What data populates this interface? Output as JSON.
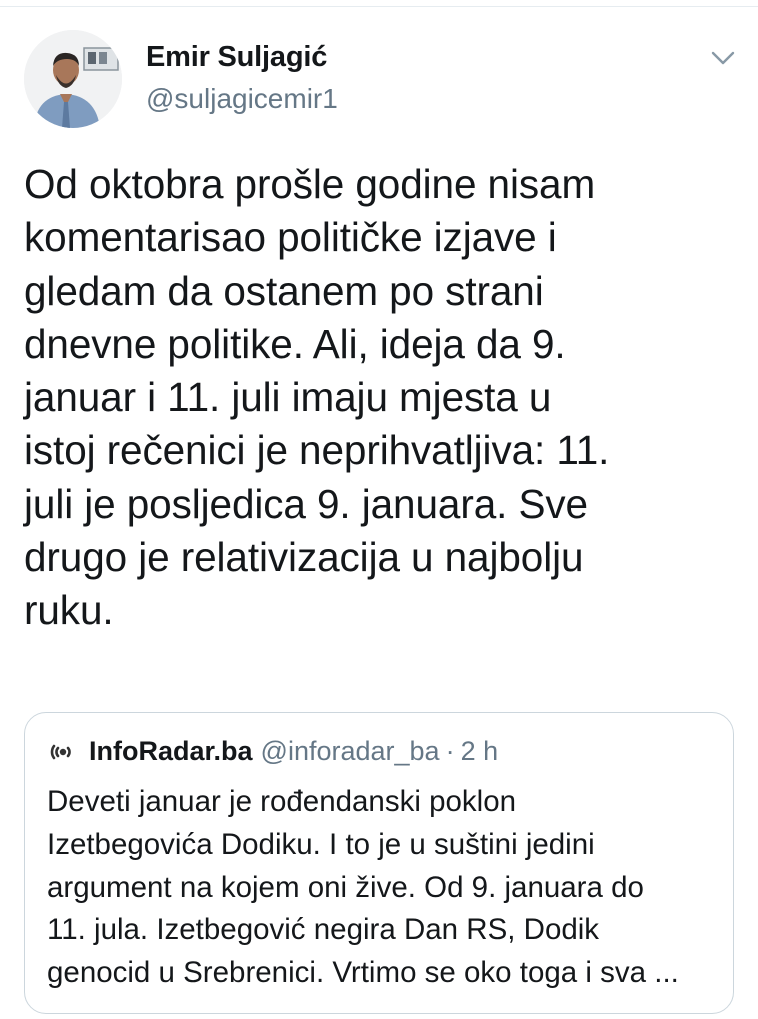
{
  "tweet": {
    "author": {
      "display_name": "Emir Suljagić",
      "handle": "@suljagicemir1",
      "avatar_icon": "user-photo-avatar"
    },
    "menu_icon": "chevron-down-icon",
    "text": "Od oktobra prošle godine nisam\nkomentarisao političke izjave i\ngledam da ostanem po strani\ndnevne politike. Ali, ideja da 9.\njanuar i 11. juli imaju mjesta u\nistoj rečenici je neprihvatljiva: 11.\njuli je posljedica 9. januara. Sve\ndrugo je relativizacija u najbolju\nruku."
  },
  "quoted_tweet": {
    "avatar_icon": "inforadar-logo-icon",
    "display_name": "InfoRadar.ba",
    "handle": "@inforadar_ba",
    "separator": "·",
    "time": "2 h",
    "text": "Deveti januar je rođendanski poklon\nIzetbegovića Dodiku. I to je u suštini jedini\nargument na kojem oni žive. Od 9. januara do\n11. jula. Izetbegović negira Dan RS, Dodik\ngenocid u Srebrenici. Vrtimo se oko toga i sva ..."
  },
  "colors": {
    "text_primary": "#14171a",
    "text_secondary": "#657786",
    "border": "#ccd6dd",
    "divider": "#e6ecf0"
  }
}
